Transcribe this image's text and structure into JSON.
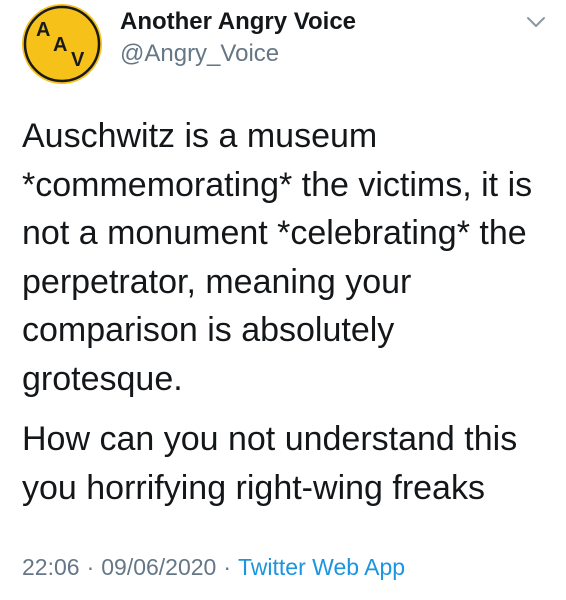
{
  "tweet": {
    "avatar": {
      "letters": [
        "A",
        "A",
        "V"
      ],
      "bg_color": "#f6c21a",
      "text_color": "#1a1a1a"
    },
    "author": {
      "display_name": "Another Angry Voice",
      "handle": "@Angry_Voice"
    },
    "menu_icon": "chevron-down-icon",
    "paragraphs": [
      "Auschwitz is a museum\n*commemorating* the victims, it is\nnot a monument *celebrating* the\nperpetrator, meaning your\ncomparison is absolutely\ngrotesque.",
      "How can you not understand this\nyou horrifying right-wing freaks"
    ],
    "meta": {
      "time": "22:06",
      "date": "09/06/2020",
      "separator": "·",
      "source": "Twitter Web App"
    },
    "colors": {
      "text": "#14171a",
      "secondary": "#657786",
      "link": "#1b95e0"
    }
  }
}
